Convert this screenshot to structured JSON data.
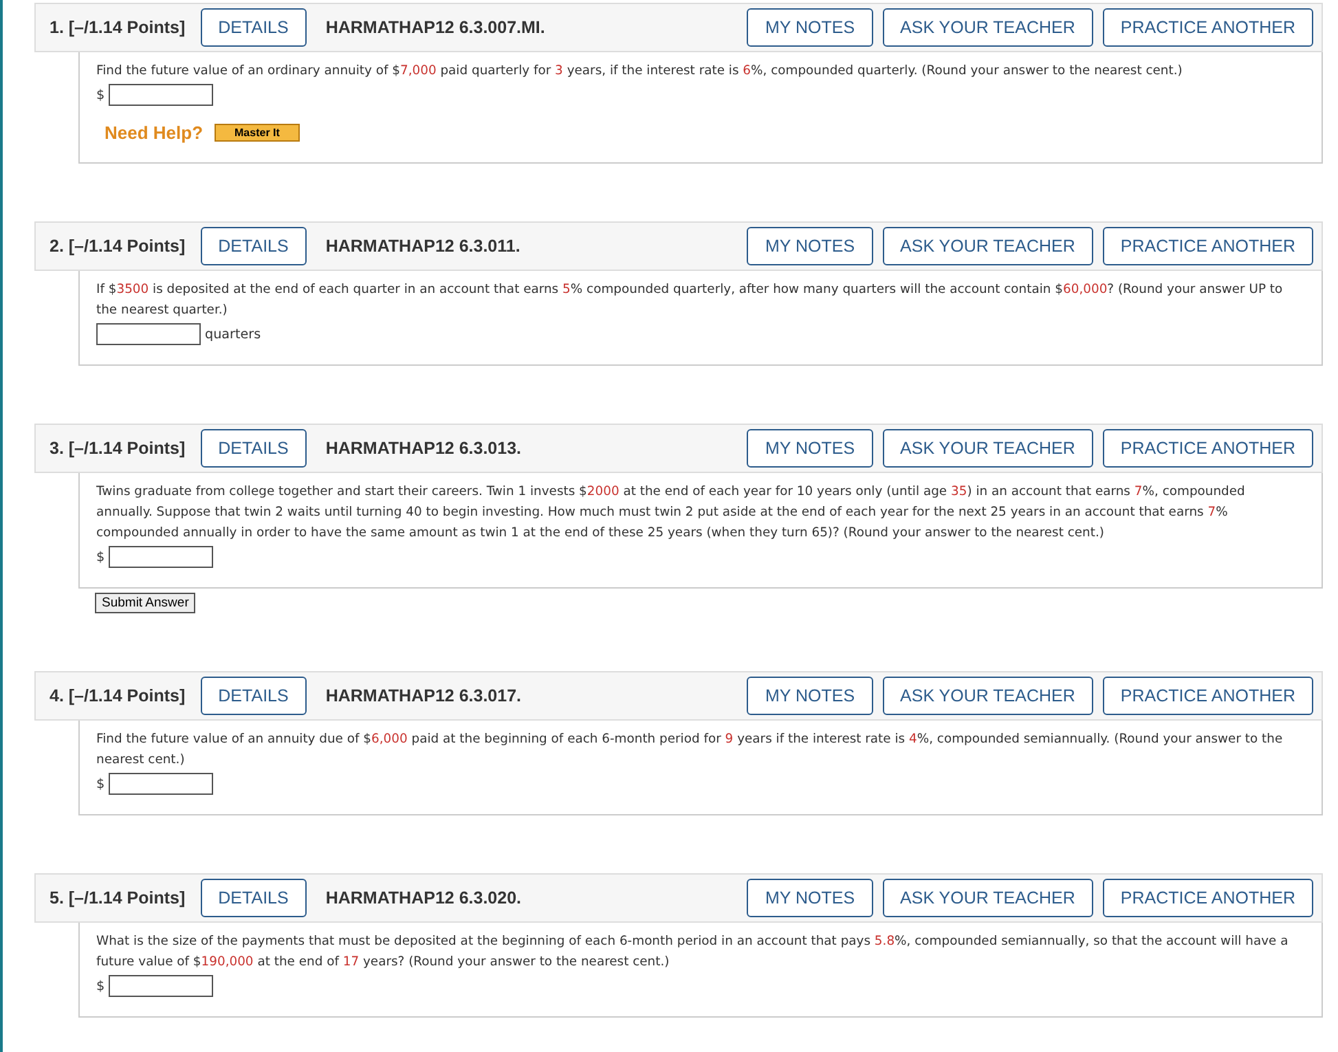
{
  "questions": [
    {
      "number": "1.",
      "points": "[–/1.14 Points]",
      "details_button": "DETAILS",
      "code": "HARMATHAP12 6.3.007.MI.",
      "actions": [
        "MY NOTES",
        "ASK YOUR TEACHER",
        "PRACTICE ANOTHER"
      ],
      "text": [
        {
          "text": "Find the future value of an ordinary annuity of $",
          "highlight": false
        },
        {
          "text": "7,000",
          "highlight": true
        },
        {
          "text": " paid quarterly for ",
          "highlight": false
        },
        {
          "text": "3",
          "highlight": true
        },
        {
          "text": " years, if the interest rate is ",
          "highlight": false
        },
        {
          "text": "6",
          "highlight": true
        },
        {
          "text": "%, compounded quarterly. (Round your answer to the nearest cent.)",
          "highlight": false
        }
      ],
      "answer": {
        "unit_before": "$"
      },
      "need_help": {
        "label": "Need Help?",
        "button": "Master It"
      }
    },
    {
      "number": "2.",
      "points": "[–/1.14 Points]",
      "details_button": "DETAILS",
      "code": "HARMATHAP12 6.3.011.",
      "actions": [
        "MY NOTES",
        "ASK YOUR TEACHER",
        "PRACTICE ANOTHER"
      ],
      "text": [
        {
          "text": "If $",
          "highlight": false
        },
        {
          "text": "3500",
          "highlight": true
        },
        {
          "text": " is deposited at the end of each quarter in an account that earns ",
          "highlight": false
        },
        {
          "text": "5",
          "highlight": true
        },
        {
          "text": "% compounded quarterly, after how many quarters will the account contain $",
          "highlight": false
        },
        {
          "text": "60,000",
          "highlight": true
        },
        {
          "text": "? (Round your answer UP to the nearest quarter.)",
          "highlight": false
        }
      ],
      "answer": {
        "unit_after": "quarters"
      }
    },
    {
      "number": "3.",
      "points": "[–/1.14 Points]",
      "details_button": "DETAILS",
      "code": "HARMATHAP12 6.3.013.",
      "actions": [
        "MY NOTES",
        "ASK YOUR TEACHER",
        "PRACTICE ANOTHER"
      ],
      "text": [
        {
          "text": "Twins graduate from college together and start their careers. Twin 1 invests $",
          "highlight": false
        },
        {
          "text": "2000",
          "highlight": true
        },
        {
          "text": " at the end of each year for 10 years only (until age ",
          "highlight": false
        },
        {
          "text": "35",
          "highlight": true
        },
        {
          "text": ") in an account that earns ",
          "highlight": false
        },
        {
          "text": "7",
          "highlight": true
        },
        {
          "text": "%, compounded annually. Suppose that twin 2 waits until turning 40 to begin investing. How much must twin 2 put aside at the end of each year for the next 25 years in an account that earns ",
          "highlight": false
        },
        {
          "text": "7",
          "highlight": true
        },
        {
          "text": "% compounded annually in order to have the same amount as twin 1 at the end of these 25 years (when they turn 65)? (Round your answer to the nearest cent.)",
          "highlight": false
        }
      ],
      "answer": {
        "unit_before": "$"
      },
      "submit_button": "Submit Answer"
    },
    {
      "number": "4.",
      "points": "[–/1.14 Points]",
      "details_button": "DETAILS",
      "code": "HARMATHAP12 6.3.017.",
      "actions": [
        "MY NOTES",
        "ASK YOUR TEACHER",
        "PRACTICE ANOTHER"
      ],
      "text": [
        {
          "text": "Find the future value of an annuity due of $",
          "highlight": false
        },
        {
          "text": "6,000",
          "highlight": true
        },
        {
          "text": " paid at the beginning of each 6-month period for ",
          "highlight": false
        },
        {
          "text": "9",
          "highlight": true
        },
        {
          "text": " years if the interest rate is ",
          "highlight": false
        },
        {
          "text": "4",
          "highlight": true
        },
        {
          "text": "%, compounded semiannually. (Round your answer to the nearest cent.)",
          "highlight": false
        }
      ],
      "answer": {
        "unit_before": "$"
      }
    },
    {
      "number": "5.",
      "points": "[–/1.14 Points]",
      "details_button": "DETAILS",
      "code": "HARMATHAP12 6.3.020.",
      "actions": [
        "MY NOTES",
        "ASK YOUR TEACHER",
        "PRACTICE ANOTHER"
      ],
      "text": [
        {
          "text": "What is the size of the payments that must be deposited at the beginning of each 6-month period in an account that pays ",
          "highlight": false
        },
        {
          "text": "5.8",
          "highlight": true
        },
        {
          "text": "%, compounded semiannually, so that the account will have a future value of $",
          "highlight": false
        },
        {
          "text": "190,000",
          "highlight": true
        },
        {
          "text": " at the end of ",
          "highlight": false
        },
        {
          "text": "17",
          "highlight": true
        },
        {
          "text": " years? (Round your answer to the nearest cent.)",
          "highlight": false
        }
      ],
      "answer": {
        "unit_before": "$"
      }
    }
  ]
}
